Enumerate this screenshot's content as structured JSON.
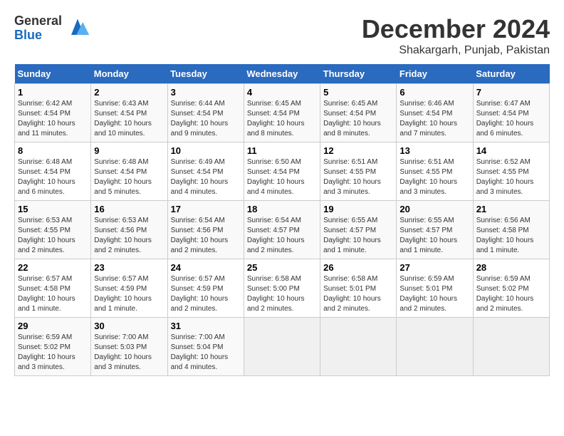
{
  "header": {
    "logo_line1": "General",
    "logo_line2": "Blue",
    "month": "December 2024",
    "location": "Shakargarh, Punjab, Pakistan"
  },
  "weekdays": [
    "Sunday",
    "Monday",
    "Tuesday",
    "Wednesday",
    "Thursday",
    "Friday",
    "Saturday"
  ],
  "weeks": [
    [
      {
        "day": "1",
        "sunrise": "6:42 AM",
        "sunset": "4:54 PM",
        "daylight": "10 hours and 11 minutes."
      },
      {
        "day": "2",
        "sunrise": "6:43 AM",
        "sunset": "4:54 PM",
        "daylight": "10 hours and 10 minutes."
      },
      {
        "day": "3",
        "sunrise": "6:44 AM",
        "sunset": "4:54 PM",
        "daylight": "10 hours and 9 minutes."
      },
      {
        "day": "4",
        "sunrise": "6:45 AM",
        "sunset": "4:54 PM",
        "daylight": "10 hours and 8 minutes."
      },
      {
        "day": "5",
        "sunrise": "6:45 AM",
        "sunset": "4:54 PM",
        "daylight": "10 hours and 8 minutes."
      },
      {
        "day": "6",
        "sunrise": "6:46 AM",
        "sunset": "4:54 PM",
        "daylight": "10 hours and 7 minutes."
      },
      {
        "day": "7",
        "sunrise": "6:47 AM",
        "sunset": "4:54 PM",
        "daylight": "10 hours and 6 minutes."
      }
    ],
    [
      {
        "day": "8",
        "sunrise": "6:48 AM",
        "sunset": "4:54 PM",
        "daylight": "10 hours and 6 minutes."
      },
      {
        "day": "9",
        "sunrise": "6:48 AM",
        "sunset": "4:54 PM",
        "daylight": "10 hours and 5 minutes."
      },
      {
        "day": "10",
        "sunrise": "6:49 AM",
        "sunset": "4:54 PM",
        "daylight": "10 hours and 4 minutes."
      },
      {
        "day": "11",
        "sunrise": "6:50 AM",
        "sunset": "4:54 PM",
        "daylight": "10 hours and 4 minutes."
      },
      {
        "day": "12",
        "sunrise": "6:51 AM",
        "sunset": "4:55 PM",
        "daylight": "10 hours and 3 minutes."
      },
      {
        "day": "13",
        "sunrise": "6:51 AM",
        "sunset": "4:55 PM",
        "daylight": "10 hours and 3 minutes."
      },
      {
        "day": "14",
        "sunrise": "6:52 AM",
        "sunset": "4:55 PM",
        "daylight": "10 hours and 3 minutes."
      }
    ],
    [
      {
        "day": "15",
        "sunrise": "6:53 AM",
        "sunset": "4:55 PM",
        "daylight": "10 hours and 2 minutes."
      },
      {
        "day": "16",
        "sunrise": "6:53 AM",
        "sunset": "4:56 PM",
        "daylight": "10 hours and 2 minutes."
      },
      {
        "day": "17",
        "sunrise": "6:54 AM",
        "sunset": "4:56 PM",
        "daylight": "10 hours and 2 minutes."
      },
      {
        "day": "18",
        "sunrise": "6:54 AM",
        "sunset": "4:57 PM",
        "daylight": "10 hours and 2 minutes."
      },
      {
        "day": "19",
        "sunrise": "6:55 AM",
        "sunset": "4:57 PM",
        "daylight": "10 hours and 1 minute."
      },
      {
        "day": "20",
        "sunrise": "6:55 AM",
        "sunset": "4:57 PM",
        "daylight": "10 hours and 1 minute."
      },
      {
        "day": "21",
        "sunrise": "6:56 AM",
        "sunset": "4:58 PM",
        "daylight": "10 hours and 1 minute."
      }
    ],
    [
      {
        "day": "22",
        "sunrise": "6:57 AM",
        "sunset": "4:58 PM",
        "daylight": "10 hours and 1 minute."
      },
      {
        "day": "23",
        "sunrise": "6:57 AM",
        "sunset": "4:59 PM",
        "daylight": "10 hours and 1 minute."
      },
      {
        "day": "24",
        "sunrise": "6:57 AM",
        "sunset": "4:59 PM",
        "daylight": "10 hours and 2 minutes."
      },
      {
        "day": "25",
        "sunrise": "6:58 AM",
        "sunset": "5:00 PM",
        "daylight": "10 hours and 2 minutes."
      },
      {
        "day": "26",
        "sunrise": "6:58 AM",
        "sunset": "5:01 PM",
        "daylight": "10 hours and 2 minutes."
      },
      {
        "day": "27",
        "sunrise": "6:59 AM",
        "sunset": "5:01 PM",
        "daylight": "10 hours and 2 minutes."
      },
      {
        "day": "28",
        "sunrise": "6:59 AM",
        "sunset": "5:02 PM",
        "daylight": "10 hours and 2 minutes."
      }
    ],
    [
      {
        "day": "29",
        "sunrise": "6:59 AM",
        "sunset": "5:02 PM",
        "daylight": "10 hours and 3 minutes."
      },
      {
        "day": "30",
        "sunrise": "7:00 AM",
        "sunset": "5:03 PM",
        "daylight": "10 hours and 3 minutes."
      },
      {
        "day": "31",
        "sunrise": "7:00 AM",
        "sunset": "5:04 PM",
        "daylight": "10 hours and 4 minutes."
      },
      null,
      null,
      null,
      null
    ]
  ]
}
